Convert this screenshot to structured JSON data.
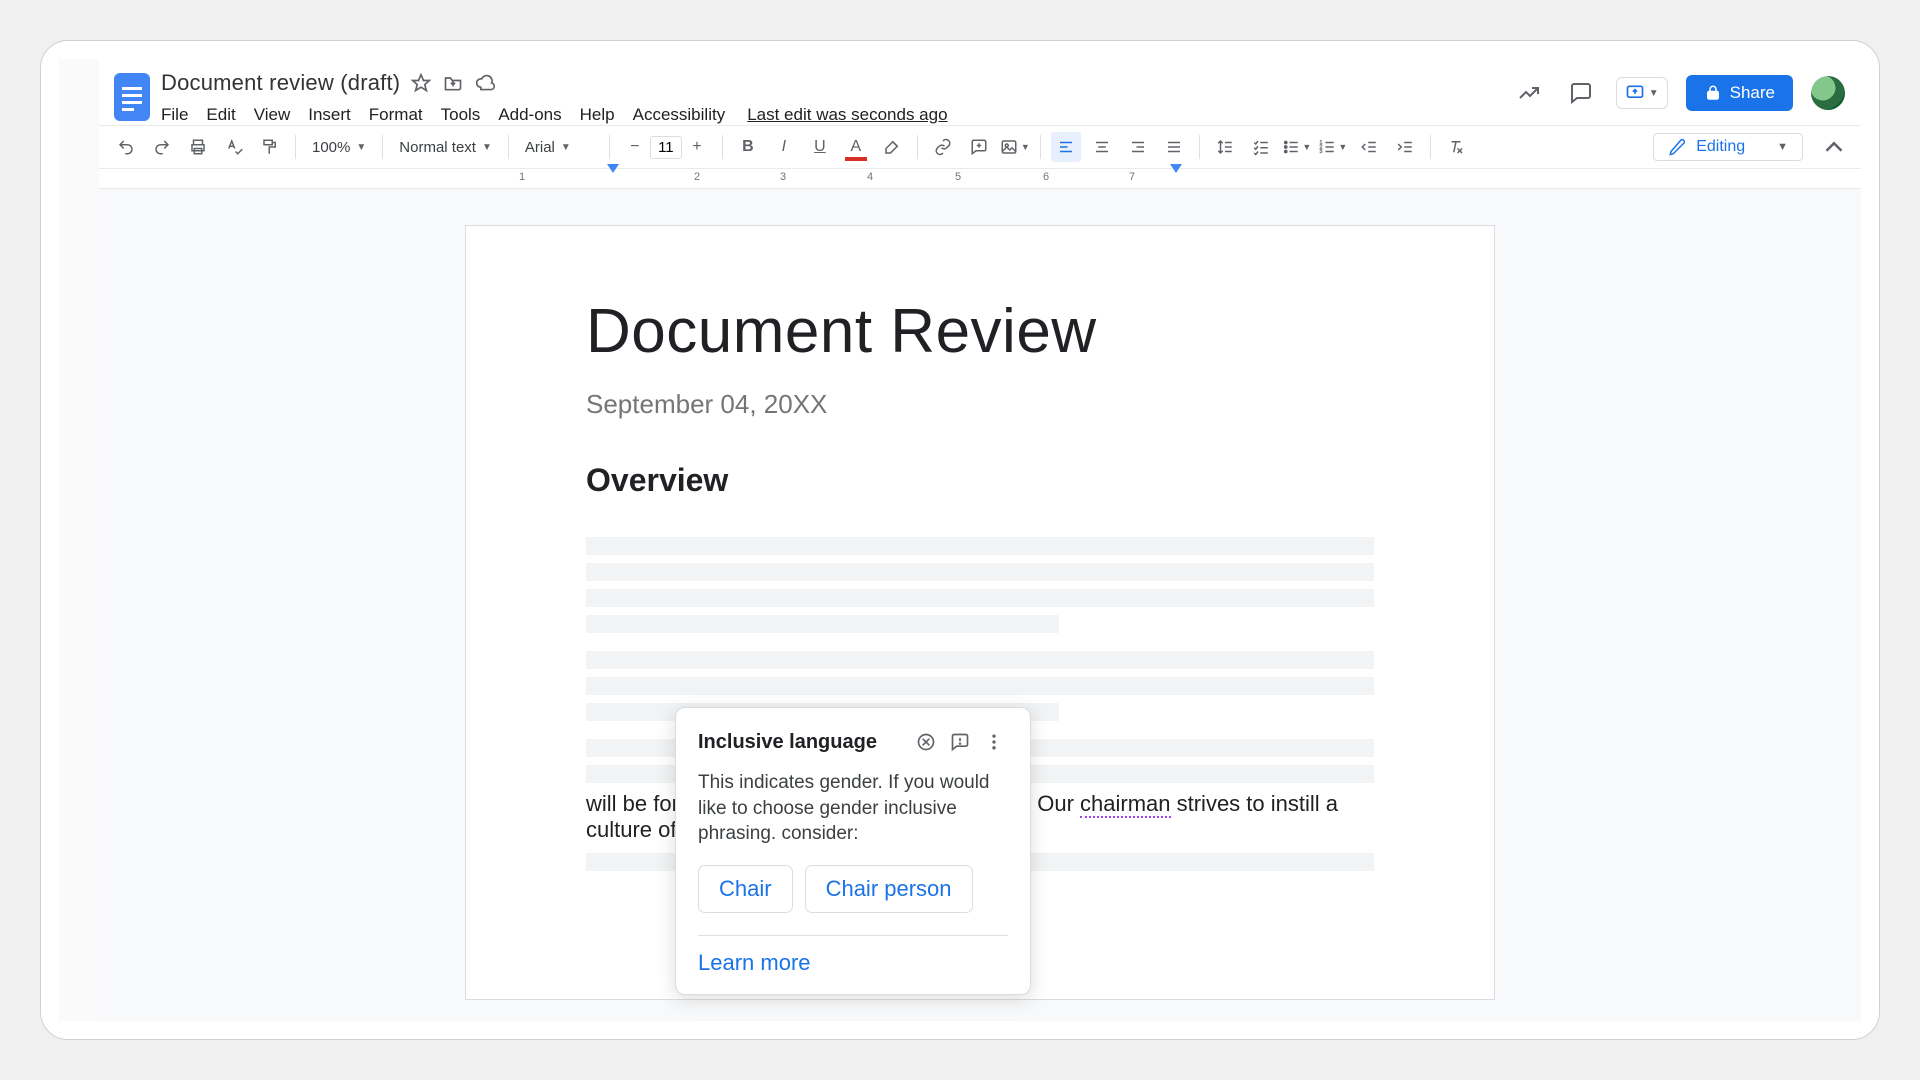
{
  "header": {
    "doc_title": "Document review (draft)",
    "last_edit": "Last edit was seconds ago",
    "share_label": "Share"
  },
  "menubar": [
    "File",
    "Edit",
    "View",
    "Insert",
    "Format",
    "Tools",
    "Add-ons",
    "Help",
    "Accessibility"
  ],
  "toolbar": {
    "zoom": "100%",
    "style": "Normal text",
    "font": "Arial",
    "font_size": "11",
    "mode": "Editing"
  },
  "ruler": {
    "marks": [
      1,
      2,
      3,
      4,
      5,
      6,
      7
    ]
  },
  "document": {
    "h1": "Document Review",
    "date": "September 04, 20XX",
    "h2": "Overview",
    "body_prefix": "will be for the rest of the company weekly too. Our ",
    "flagged_word": "chairman",
    "body_suffix": " strives to instill a culture of product excellence."
  },
  "popup": {
    "title": "Inclusive language",
    "message": "This indicates gender. If you would like to choose gender inclusive phrasing. consider:",
    "suggestions": [
      "Chair",
      "Chair person"
    ],
    "learn_more": "Learn more"
  }
}
